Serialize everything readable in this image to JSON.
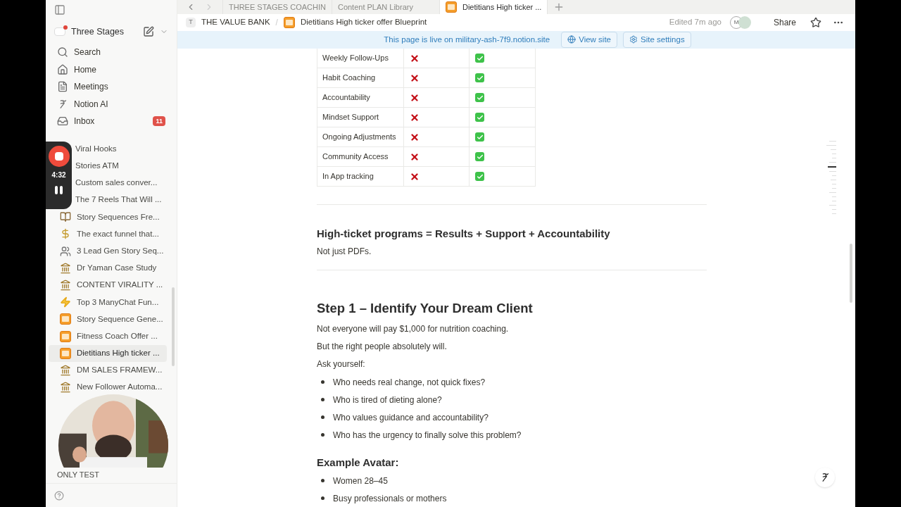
{
  "sidebar": {
    "workspace": "Three Stages",
    "nav": [
      {
        "kind": "search",
        "label": "Search"
      },
      {
        "kind": "home",
        "label": "Home"
      },
      {
        "kind": "meetings",
        "label": "Meetings"
      },
      {
        "kind": "ai",
        "label": "Notion AI"
      },
      {
        "kind": "inbox",
        "label": "Inbox",
        "badge": "11"
      }
    ],
    "pages": [
      {
        "kind": "plain",
        "label": "Viral Hooks",
        "selected": false
      },
      {
        "kind": "plain",
        "label": "Stories ATM",
        "selected": false
      },
      {
        "kind": "plain",
        "label": "Custom sales conver...",
        "selected": false
      },
      {
        "kind": "plain",
        "label": "The 7 Reels That Will ...",
        "selected": false
      },
      {
        "kind": "books",
        "label": "Story Sequences Fre...",
        "selected": false
      },
      {
        "kind": "money",
        "label": "The exact funnel that...",
        "selected": false
      },
      {
        "kind": "people",
        "label": "3 Lead Gen Story Seq...",
        "selected": false
      },
      {
        "kind": "bank",
        "label": "Dr Yaman Case Study",
        "selected": false
      },
      {
        "kind": "bank",
        "label": "CONTENT VIRALITY ...",
        "selected": false
      },
      {
        "kind": "bolt",
        "label": "Top 3 ManyChat Fun...",
        "selected": false
      },
      {
        "kind": "offer",
        "label": "Story Sequence Gene...",
        "selected": false
      },
      {
        "kind": "offer",
        "label": "Fitness Coach Offer ...",
        "selected": false
      },
      {
        "kind": "offer",
        "label": "Dietitians High ticker ...",
        "selected": true
      },
      {
        "kind": "bank",
        "label": "DM SALES FRAMEW...",
        "selected": false
      },
      {
        "kind": "bank",
        "label": "New Follower Automa...",
        "selected": false
      }
    ],
    "bottom_page": "ONLY TEST",
    "recorder": {
      "time": "4:32"
    }
  },
  "tabs": [
    {
      "label": "THREE STAGES COACHIN",
      "selected": false
    },
    {
      "label": "Content PLAN Library",
      "selected": false
    },
    {
      "label": "Dietitians High ticker ...",
      "selected": true
    }
  ],
  "breadcrumb": [
    {
      "kind": "letter",
      "icon": "T",
      "label": "THE VALUE BANK"
    },
    {
      "kind": "offer",
      "separator": "/",
      "label": "Dietitians High ticker offer Blueprint"
    }
  ],
  "topbar": {
    "edited": "Edited 7m ago",
    "avatar": "M",
    "share": "Share"
  },
  "banner": {
    "text": "This page is live on military-ash-7f9.notion.site",
    "buttons": [
      {
        "kind": "globe",
        "label": "View site"
      },
      {
        "kind": "gear",
        "label": "Site settings"
      }
    ]
  },
  "table": {
    "rows": [
      {
        "column_1": "Weekly Follow-Ups",
        "column_2": false,
        "column_3": true
      },
      {
        "column_1": "Habit Coaching",
        "column_2": false,
        "column_3": true
      },
      {
        "column_1": "Accountability",
        "column_2": false,
        "column_3": true
      },
      {
        "column_1": "Mindset Support",
        "column_2": false,
        "column_3": true
      },
      {
        "column_1": "Ongoing Adjustments",
        "column_2": false,
        "column_3": true
      },
      {
        "column_1": "Community Access",
        "column_2": false,
        "column_3": true
      },
      {
        "column_1": "In App tracking",
        "column_2": false,
        "column_3": true
      }
    ]
  },
  "blocks": [
    {
      "kind": "divider"
    },
    {
      "kind": "h3",
      "text": "High-ticket programs = Results + Support + Accountability"
    },
    {
      "kind": "p",
      "text": "Not just PDFs."
    },
    {
      "kind": "divider"
    },
    {
      "kind": "h2",
      "text": "Step 1 – Identify Your Dream Client"
    },
    {
      "kind": "p",
      "text": "Not everyone will pay $1,000 for nutrition coaching."
    },
    {
      "kind": "p",
      "text": "But the right people absolutely will."
    },
    {
      "kind": "p",
      "text": "Ask yourself:"
    },
    {
      "kind": "bullet",
      "text": "Who needs real change, not quick fixes?"
    },
    {
      "kind": "bullet",
      "text": "Who is tired of dieting alone?"
    },
    {
      "kind": "bullet",
      "text": "Who values guidance and accountability?"
    },
    {
      "kind": "bullet",
      "text": "Who has the urgency to finally solve this problem?"
    },
    {
      "kind": "h3big",
      "text": "Example Avatar:"
    },
    {
      "kind": "bullet",
      "text": "Women 28–45"
    },
    {
      "kind": "bullet",
      "text": "Busy professionals or mothers"
    }
  ]
}
